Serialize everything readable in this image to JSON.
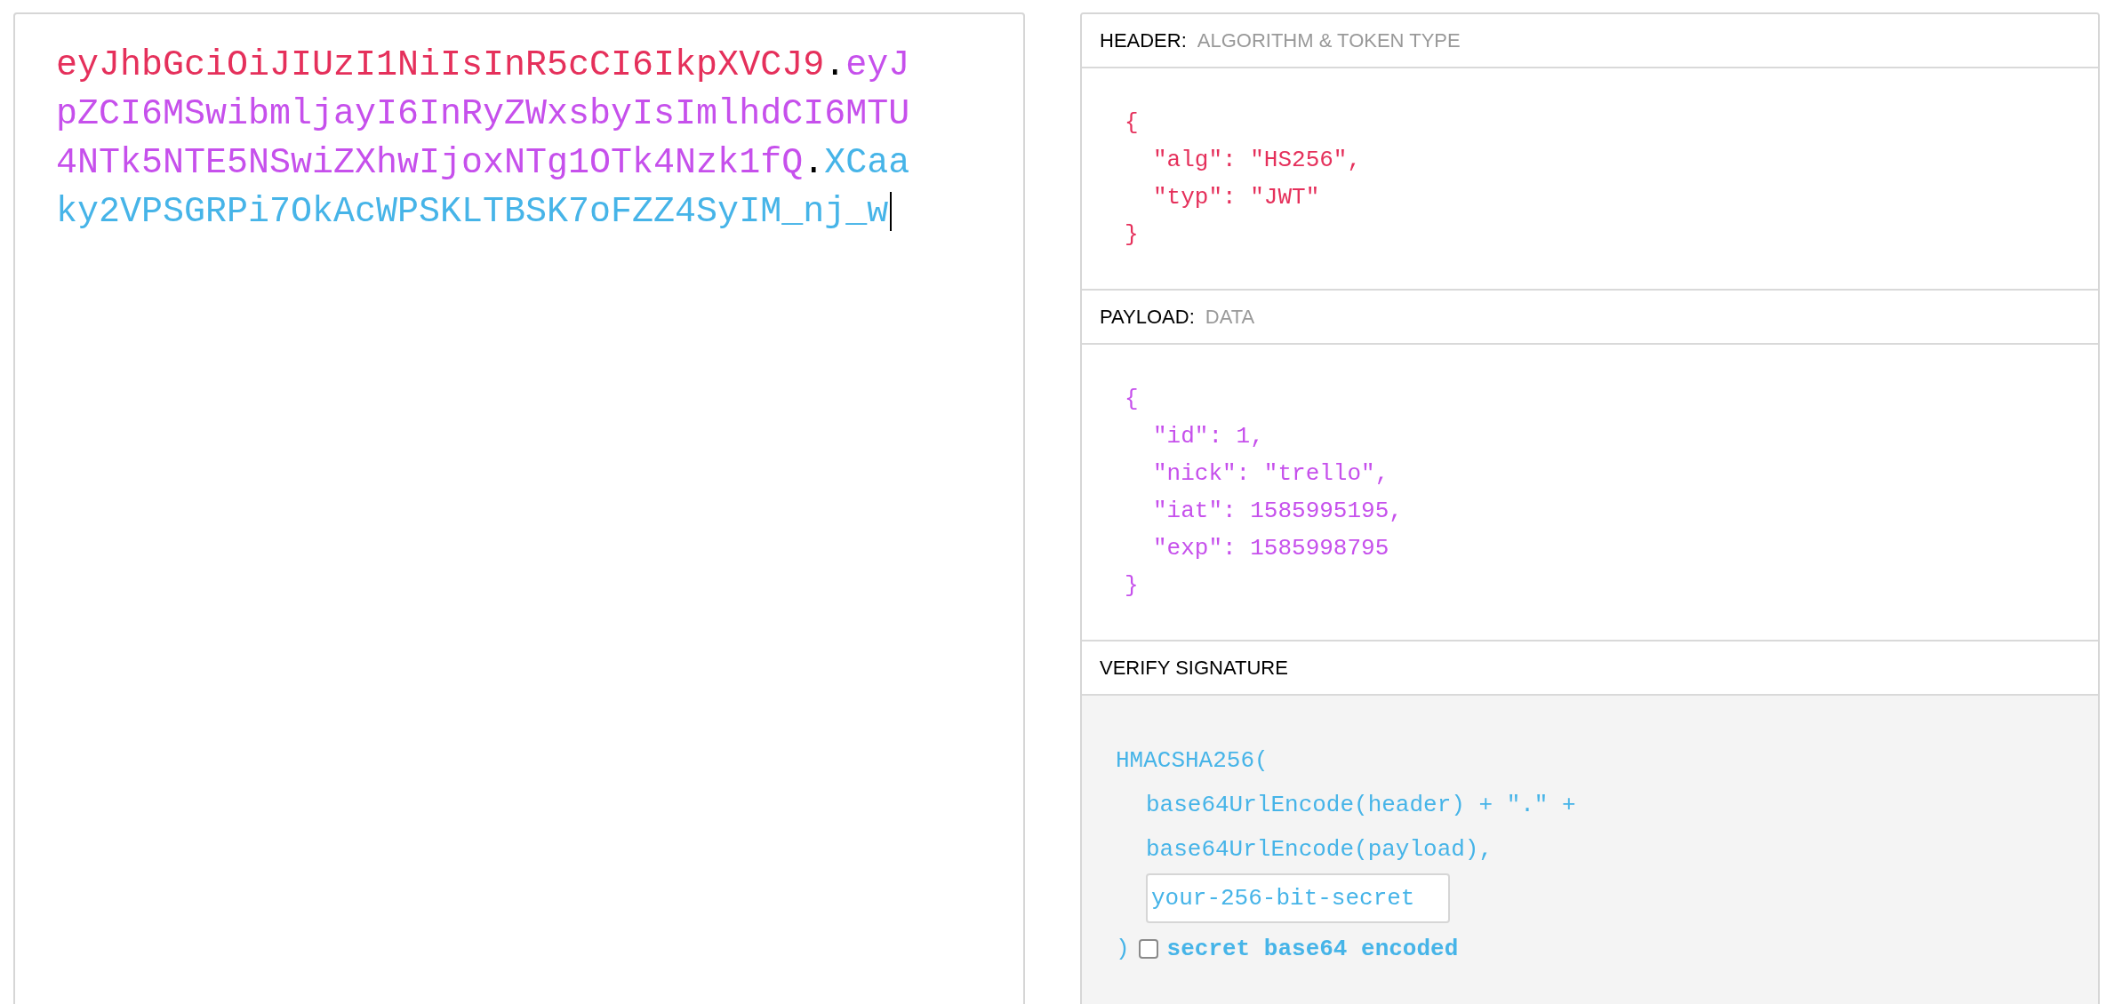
{
  "encoded": {
    "parts": [
      {
        "text": "eyJhbGciOiJIUzI1NiIsInR5cCI6IkpXVCJ9",
        "color": "#e5305b"
      },
      {
        "text": ".",
        "color": "#000000"
      },
      {
        "text": "eyJpZCI6MSwibmljayI6InRyZWxsbyIsImlhdCI6MTU4NTk5NTE5NSwiZXhwIjoxNTg1OTk4Nzk1fQ",
        "color": "#c650ec"
      },
      {
        "text": ".",
        "color": "#000000"
      },
      {
        "text": "XCaaky2VPSGRPi7OkAcWPSKLTBSK7oFZZ4SyIM_nj_w",
        "color": "#46b4e8"
      }
    ],
    "cursor": true
  },
  "sections": [
    {
      "kind": "json",
      "title": "HEADER:",
      "subtitle": "ALGORITHM & TOKEN TYPE",
      "color": "#e5305b",
      "open": "{",
      "lines": [
        "\"alg\": \"HS256\",",
        "\"typ\": \"JWT\""
      ],
      "close": "}"
    },
    {
      "kind": "json",
      "title": "PAYLOAD:",
      "subtitle": "DATA",
      "color": "#c650ec",
      "open": "{",
      "lines": [
        "\"id\": 1,",
        "\"nick\": \"trello\",",
        "\"iat\": 1585995195,",
        "\"exp\": 1585998795"
      ],
      "close": "}"
    },
    {
      "kind": "verify",
      "title": "VERIFY SIGNATURE",
      "color": "#46b4e8",
      "open": "HMACSHA256(",
      "lines": [
        "base64UrlEncode(header) + \".\" +",
        "base64UrlEncode(payload),"
      ],
      "secret": {
        "value": "your-256-bit-secret"
      },
      "close": ")",
      "base64": {
        "label": "secret base64 encoded",
        "checked": false
      }
    }
  ]
}
